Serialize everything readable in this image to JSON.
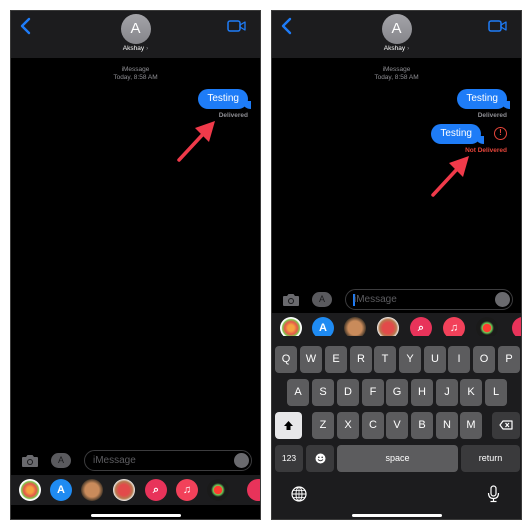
{
  "colors": {
    "accent": "#1e7cf7",
    "error": "#e5453a",
    "background": "#000000",
    "header": "#1c1c1e",
    "annotation_arrow": "#f03a4a"
  },
  "left_screen": {
    "header": {
      "back_icon": "chevron-left-icon",
      "avatar_initial": "A",
      "contact_name": "Akshay",
      "contact_chevron": "›",
      "video_icon": "video-camera-icon"
    },
    "conversation": {
      "service": "iMessage",
      "timestamp": "Today, 8:58 AM",
      "messages": [
        {
          "text": "Testing",
          "status": "Delivered"
        }
      ]
    },
    "input_bar": {
      "camera_icon": "camera-icon",
      "apps_icon": "app-store-icon",
      "placeholder": "iMessage",
      "audio_icon": "waveform-icon"
    },
    "app_tray": [
      "Photos",
      "App Store",
      "Memoji",
      "Memoji Stickers",
      "Search Images",
      "Music",
      "Activity",
      "Digital Touch"
    ]
  },
  "right_screen": {
    "header": {
      "back_icon": "chevron-left-icon",
      "avatar_initial": "A",
      "contact_name": "Akshay",
      "contact_chevron": "›",
      "video_icon": "video-camera-icon"
    },
    "conversation": {
      "service": "iMessage",
      "timestamp": "Today, 8:58 AM",
      "messages": [
        {
          "text": "Testing",
          "status": "Delivered"
        },
        {
          "text": "Testing",
          "status": "Not Delivered",
          "error_icon": "!"
        }
      ]
    },
    "input_bar": {
      "camera_icon": "camera-icon",
      "apps_icon": "app-store-icon",
      "placeholder": "iMessage",
      "audio_icon": "waveform-icon"
    },
    "app_tray": [
      "Photos",
      "App Store",
      "Memoji",
      "Memoji Stickers",
      "Search Images",
      "Music",
      "Activity",
      "Digital Touch"
    ],
    "keyboard": {
      "row1": [
        "Q",
        "W",
        "E",
        "R",
        "T",
        "Y",
        "U",
        "I",
        "O",
        "P"
      ],
      "row2": [
        "A",
        "S",
        "D",
        "F",
        "G",
        "H",
        "J",
        "K",
        "L"
      ],
      "row3": [
        "Z",
        "X",
        "C",
        "V",
        "B",
        "N",
        "M"
      ],
      "numbers": "123",
      "space": "space",
      "return": "return",
      "shift_icon": "shift-icon",
      "delete_icon": "delete-backward-icon",
      "emoji_icon": "emoji-icon",
      "globe_icon": "globe-icon",
      "mic_icon": "microphone-icon"
    }
  }
}
